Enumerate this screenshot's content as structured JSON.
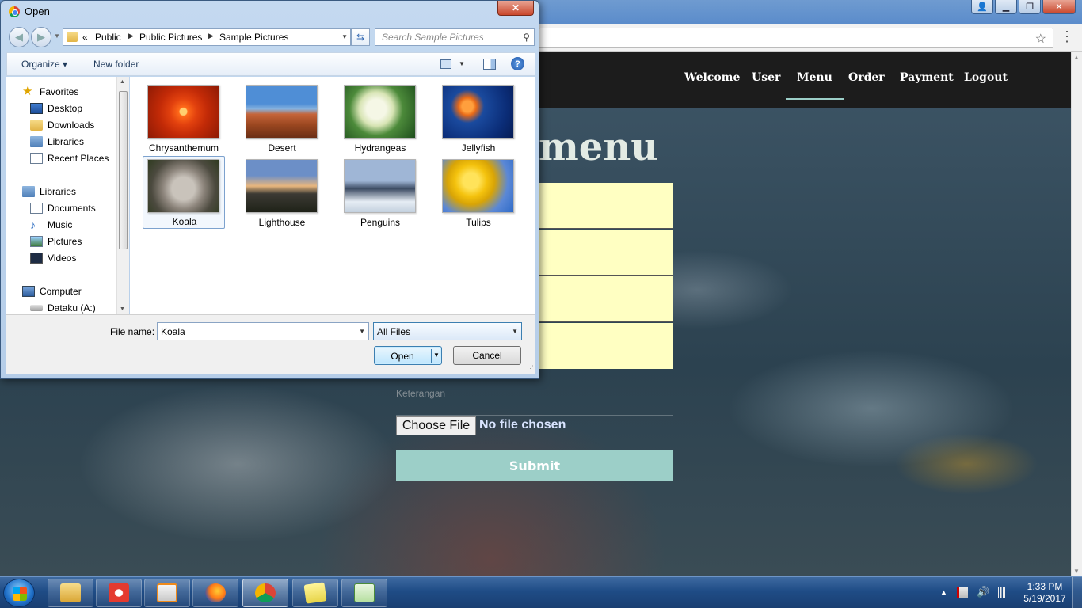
{
  "browser": {
    "win_controls": {
      "minimize": "▁",
      "restore": "❐",
      "close": "✕"
    }
  },
  "site": {
    "nav": [
      "Welcome",
      "User",
      "Menu",
      "Order",
      "Payment",
      "Logout"
    ],
    "active_nav": "Menu",
    "heading": "menu",
    "keterangan_label": "Keterangan",
    "choose_file_label": "Choose File",
    "file_status": "No file chosen",
    "submit_label": "Submit",
    "accent_color": "#9ccfc8",
    "field_color": "#ffffc2"
  },
  "dialog": {
    "title": "Open",
    "close_glyph": "✕",
    "breadcrumb": {
      "prefix": "«",
      "items": [
        "Public",
        "Public Pictures",
        "Sample Pictures"
      ]
    },
    "search_placeholder": "Search Sample Pictures",
    "toolbar": {
      "organize": "Organize",
      "new_folder": "New folder",
      "help": "?"
    },
    "nav_tree": {
      "favorites": "Favorites",
      "favorites_items": [
        "Desktop",
        "Downloads",
        "Libraries",
        "Recent Places"
      ],
      "libraries": "Libraries",
      "libraries_items": [
        "Documents",
        "Music",
        "Pictures",
        "Videos"
      ],
      "computer": "Computer",
      "computer_items": [
        "Dataku (A:)"
      ]
    },
    "files": [
      "Chrysanthemum",
      "Desert",
      "Hydrangeas",
      "Jellyfish",
      "Koala",
      "Lighthouse",
      "Penguins",
      "Tulips"
    ],
    "selected_file": "Koala",
    "file_name_label": "File name:",
    "file_name_value": "Koala",
    "file_type_value": "All Files",
    "open_label": "Open",
    "cancel_label": "Cancel"
  },
  "taskbar": {
    "time": "1:33 PM",
    "date": "5/19/2017",
    "apps": [
      "windows-explorer",
      "app-icon",
      "media-player",
      "firefox",
      "chrome",
      "sticky-notes",
      "chart-app"
    ],
    "active_app": "chrome"
  }
}
